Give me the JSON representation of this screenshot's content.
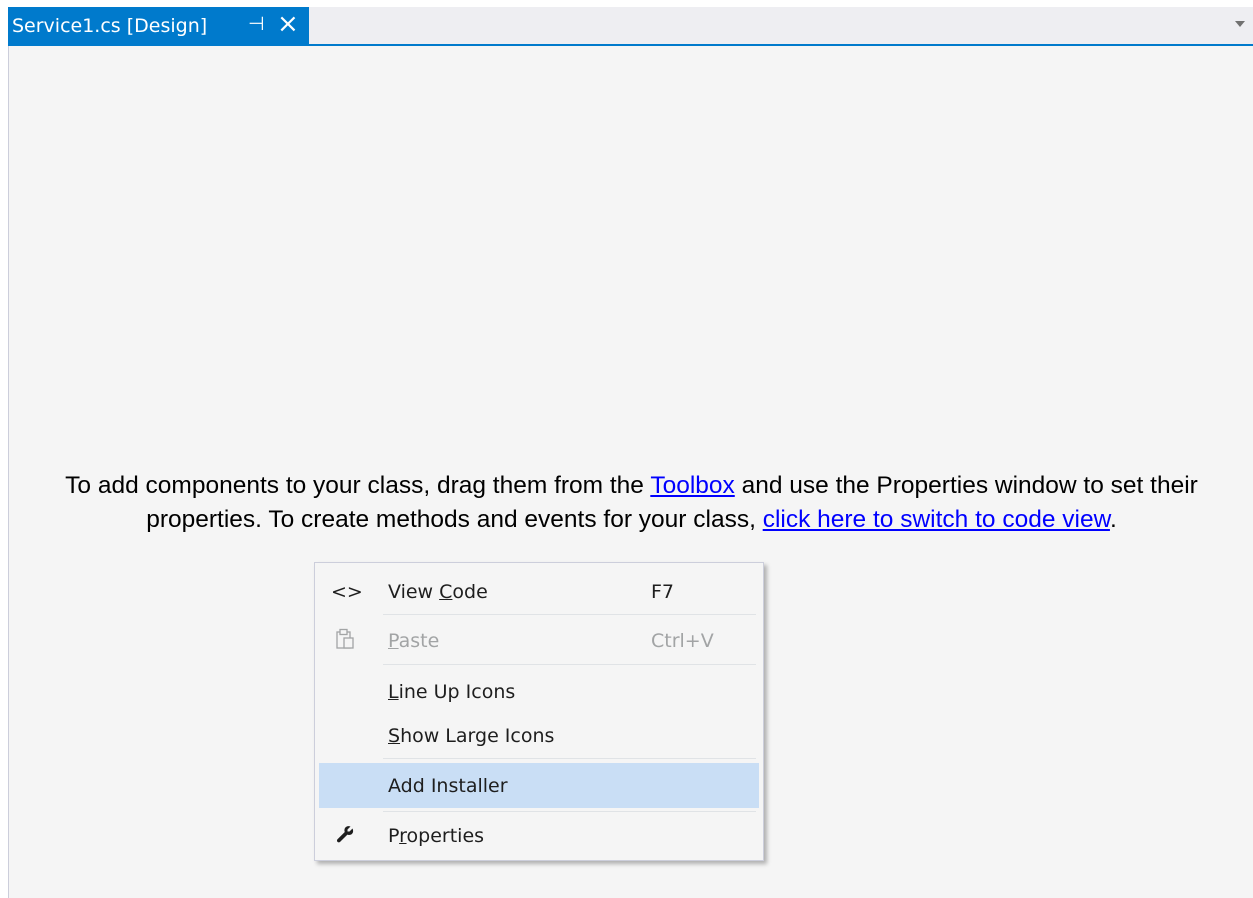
{
  "document_tab": {
    "title": "Service1.cs [Design]",
    "pin_icon": "pin-icon",
    "close_icon": "close-icon"
  },
  "tab_overflow_icon": "chevron-down-icon",
  "designer": {
    "text_1": "To add components to your class, drag them from the ",
    "toolbox_link": "Toolbox",
    "text_2": " and use the Properties window to set their properties. To create methods and events for your class, ",
    "code_view_link": "click here to switch to code view",
    "text_3": "."
  },
  "context_menu": {
    "items": [
      {
        "icon": "code-brackets-icon",
        "label_pre": "View ",
        "accel": "C",
        "label_post": "ode",
        "shortcut": "F7",
        "enabled": true
      },
      {
        "icon": "paste-icon",
        "label_pre": "",
        "accel": "P",
        "label_post": "aste",
        "shortcut": "Ctrl+V",
        "enabled": false
      },
      {
        "label_pre": "",
        "accel": "L",
        "label_post": "ine Up Icons",
        "enabled": true
      },
      {
        "label_pre": "",
        "accel": "S",
        "label_post": "how Large Icons",
        "enabled": true
      },
      {
        "label_pre": "Add Installer",
        "accel": "",
        "label_post": "",
        "enabled": true,
        "highlighted": true
      },
      {
        "icon": "wrench-icon",
        "label_pre": "P",
        "accel": "r",
        "label_post": "operties",
        "enabled": true
      }
    ]
  },
  "colors": {
    "accent": "#007acc",
    "link": "#0000ff",
    "menu_highlight": "#c9def5",
    "disabled_text": "#a2a4a5"
  }
}
